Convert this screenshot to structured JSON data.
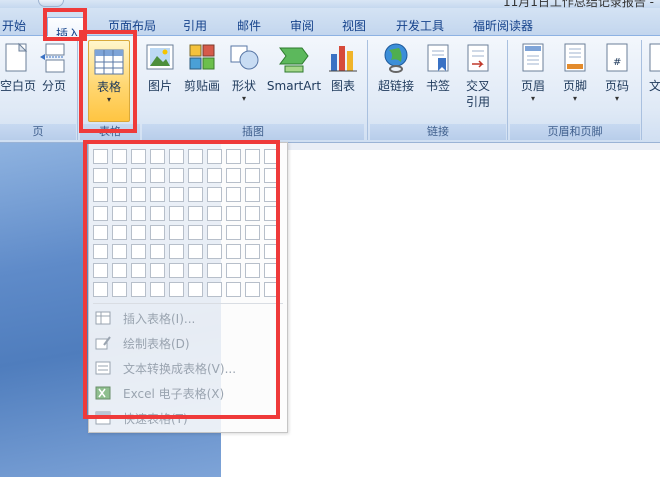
{
  "window": {
    "title": "11月1日工作总结记录报告 -"
  },
  "tabs": [
    "开始",
    "插入",
    "页面布局",
    "引用",
    "邮件",
    "审阅",
    "视图",
    "开发工具",
    "福昕阅读器"
  ],
  "ribbon": {
    "pages_group": {
      "label": "页",
      "buttons": [
        "空白页",
        "分页"
      ]
    },
    "tables_group": {
      "label": "表格",
      "button": "表格"
    },
    "illustrations_group": {
      "label": "插图",
      "buttons": [
        "图片",
        "剪贴画",
        "形状",
        "SmartArt",
        "图表"
      ]
    },
    "links_group": {
      "label": "链接",
      "buttons": [
        "超链接",
        "书签",
        "交叉引用"
      ]
    },
    "header_footer_group": {
      "label": "页眉和页脚",
      "buttons": [
        "页眉",
        "页脚",
        "页码"
      ]
    },
    "text_group_partial": "文"
  },
  "table_menu": {
    "grid": {
      "columns": 10,
      "rows": 8
    },
    "items": [
      "插入表格(I)...",
      "绘制表格(D)",
      "文本转换成表格(V)...",
      "Excel 电子表格(X)",
      "快速表格(T)"
    ]
  },
  "highlight_color": "#ef3a3a"
}
